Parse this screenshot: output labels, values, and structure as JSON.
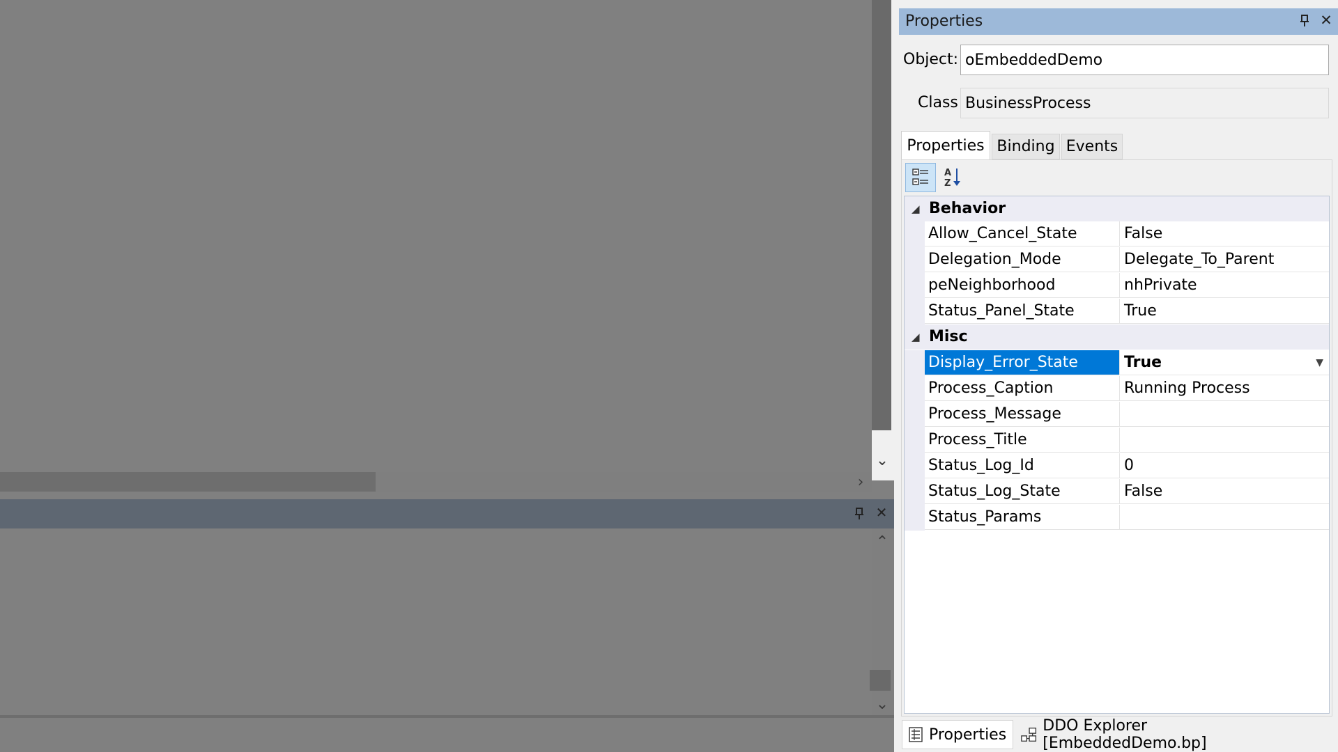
{
  "properties_panel": {
    "title": "Properties",
    "object_label": "Object:",
    "object_value": "oEmbeddedDemo",
    "class_label": "Class",
    "class_value": "BusinessProcess",
    "tabs": [
      {
        "label": "Properties",
        "active": true
      },
      {
        "label": "Binding",
        "active": false
      },
      {
        "label": "Events",
        "active": false
      }
    ],
    "categories": [
      {
        "name": "Behavior",
        "expanded": true,
        "properties": [
          {
            "name": "Allow_Cancel_State",
            "value": "False"
          },
          {
            "name": "Delegation_Mode",
            "value": "Delegate_To_Parent"
          },
          {
            "name": "peNeighborhood",
            "value": "nhPrivate"
          },
          {
            "name": "Status_Panel_State",
            "value": "True"
          }
        ]
      },
      {
        "name": "Misc",
        "expanded": true,
        "properties": [
          {
            "name": "Display_Error_State",
            "value": "True",
            "selected": true
          },
          {
            "name": "Process_Caption",
            "value": "Running Process"
          },
          {
            "name": "Process_Message",
            "value": ""
          },
          {
            "name": "Process_Title",
            "value": ""
          },
          {
            "name": "Status_Log_Id",
            "value": "0"
          },
          {
            "name": "Status_Log_State",
            "value": "False"
          },
          {
            "name": "Status_Params",
            "value": ""
          }
        ]
      }
    ]
  },
  "bottom_tabs": [
    {
      "label": "Properties",
      "icon": "properties-grid-icon"
    },
    {
      "label": "DDO Explorer [EmbeddedDemo.bp]",
      "icon": "ddo-tree-icon"
    }
  ],
  "colors": {
    "panel_title_bar": "#9db9d9",
    "selection": "#0078d7",
    "workspace": "#808080",
    "output_header": "#5e6772"
  }
}
